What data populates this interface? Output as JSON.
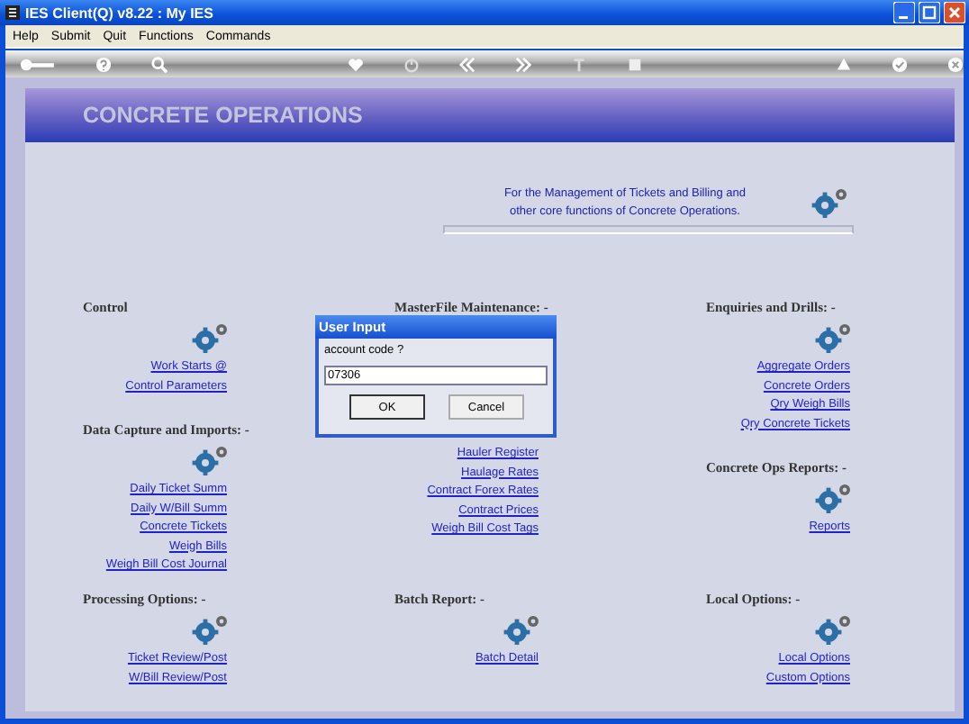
{
  "window": {
    "title": "IES Client(Q) v8.22 : My IES"
  },
  "menu": [
    "Help",
    "Submit",
    "Quit",
    "Functions",
    "Commands"
  ],
  "banner": {
    "title": "CONCRETE OPERATIONS"
  },
  "intro": [
    "For the Management of Tickets and Billing and",
    "other core functions of Concrete Operations."
  ],
  "columns": [
    {
      "sections": [
        {
          "heading": "Control",
          "links": [
            "Work Starts @",
            "Control Parameters"
          ]
        },
        {
          "heading": "Data Capture and Imports: -",
          "links": [
            "Daily Ticket Summ",
            "Daily W/Bill Summ",
            "Concrete Tickets",
            "Weigh Bills",
            "Weigh Bill Cost Journal"
          ]
        }
      ]
    },
    {
      "sections": [
        {
          "heading": "MasterFile Maintenance: -",
          "links": [
            "Hauler Register",
            "Haulage Rates",
            "Contract Forex Rates",
            "Contract Prices",
            "Weigh Bill Cost Tags"
          ]
        }
      ]
    },
    {
      "sections": [
        {
          "heading": "Enquiries and Drills: -",
          "links": [
            "Aggregate Orders",
            "Concrete Orders",
            "Qry Weigh Bills",
            "Qry Concrete Tickets"
          ]
        },
        {
          "heading": "Concrete Ops Reports: -",
          "links": [
            "Reports"
          ]
        }
      ]
    }
  ],
  "bottom": [
    {
      "heading": "Processing Options: -",
      "links": [
        "Ticket Review/Post",
        "W/Bill Review/Post"
      ]
    },
    {
      "heading": "Batch Report: -",
      "links": [
        "Batch Detail"
      ]
    },
    {
      "heading": "Local Options: -",
      "links": [
        "Local Options",
        "Custom Options"
      ]
    }
  ],
  "dialog": {
    "title": "User Input",
    "prompt": "account code ?",
    "value": "07306",
    "buttons": [
      {
        "label": "OK",
        "default": true
      },
      {
        "label": "Cancel",
        "default": false
      }
    ]
  }
}
